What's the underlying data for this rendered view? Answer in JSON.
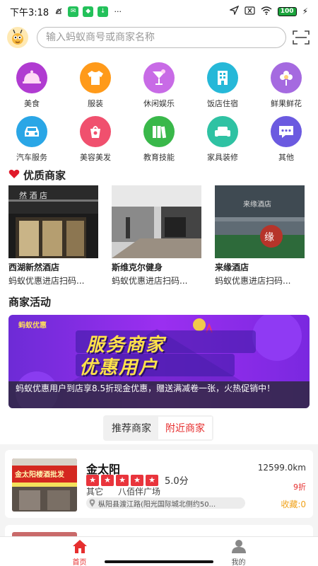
{
  "status_bar": {
    "time": "下午3:18",
    "battery": "100"
  },
  "search": {
    "placeholder": "输入蚂蚁商号或商家名称"
  },
  "categories": [
    {
      "label": "美食",
      "icon": "cloche-icon",
      "color": "#b03bd1"
    },
    {
      "label": "服装",
      "icon": "tshirt-icon",
      "color": "#ff9a1a"
    },
    {
      "label": "休闲娱乐",
      "icon": "cocktail-icon",
      "color": "#c86be6"
    },
    {
      "label": "饭店住宿",
      "icon": "building-icon",
      "color": "#26b8d8"
    },
    {
      "label": "鲜果鲜花",
      "icon": "flower-icon",
      "color": "#a56ae0"
    },
    {
      "label": "汽车服务",
      "icon": "car-icon",
      "color": "#2aa6e6"
    },
    {
      "label": "美容美发",
      "icon": "cosmetics-icon",
      "color": "#f0506e"
    },
    {
      "label": "教育技能",
      "icon": "books-icon",
      "color": "#39b84a"
    },
    {
      "label": "家具装修",
      "icon": "sofa-icon",
      "color": "#2fc2a3"
    },
    {
      "label": "其他",
      "icon": "more-icon",
      "color": "#6b5ae0"
    }
  ],
  "quality_section": {
    "title": "优质商家"
  },
  "quality_merchants": [
    {
      "name": "西湖新然酒店",
      "desc": "蚂蚁优惠进店扫码..."
    },
    {
      "name": "斯维克尔健身",
      "desc": "蚂蚁优惠进店扫码..."
    },
    {
      "name": "来缘酒店",
      "desc": "蚂蚁优惠进店扫码..."
    }
  ],
  "activity_section": {
    "title": "商家活动"
  },
  "banner": {
    "logo_text": "蚂蚁优惠",
    "headline1": "服务商家",
    "headline2": "优惠用户",
    "caption": "蚂蚁优惠用户到店享8.5折现金优惠，赠送满减卷一张，火热促销中！"
  },
  "tabs": [
    {
      "label": "推荐商家",
      "active": false
    },
    {
      "label": "附近商家",
      "active": true
    }
  ],
  "merchant_card": {
    "name": "金太阳",
    "distance": "12599.0km",
    "rating": "5.0分",
    "stars": 5,
    "category": "其它",
    "area": "八佰伴广场",
    "discount": "9折",
    "address": "枞阳县渡江路(阳光国际城北侧约50...",
    "favorites": "收藏:0",
    "photo_sign": "金太阳楼酒批发"
  },
  "bottom_nav": [
    {
      "label": "首页",
      "active": true
    },
    {
      "label": "我的",
      "active": false
    }
  ],
  "colors": {
    "accent": "#e62e2e",
    "favorite": "#f0a21a"
  }
}
